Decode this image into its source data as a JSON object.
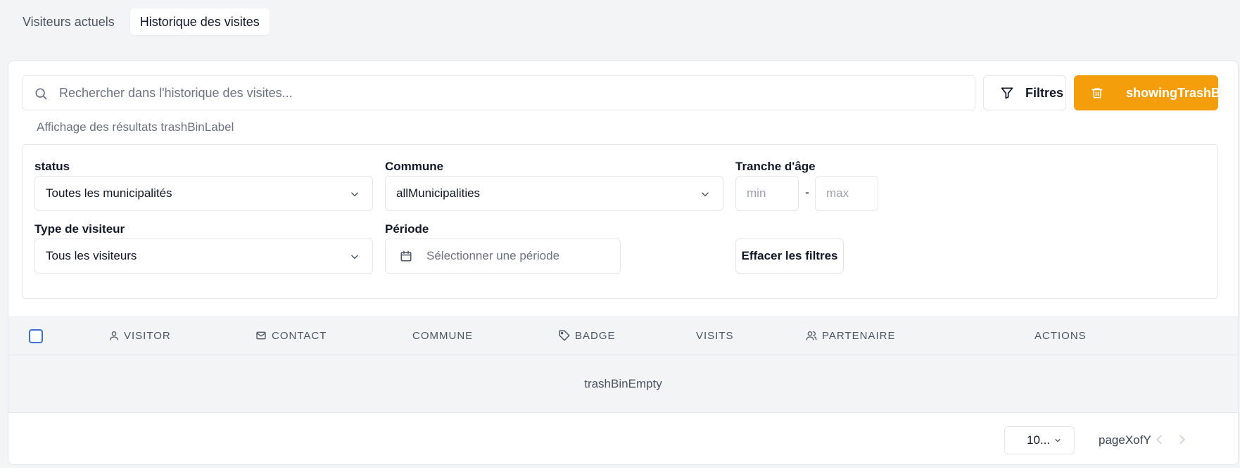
{
  "tabs": [
    {
      "label": "Visiteurs actuels",
      "active": false
    },
    {
      "label": "Historique des visites",
      "active": true
    }
  ],
  "search": {
    "placeholder": "Rechercher dans l'historique des visites...",
    "value": "",
    "icon": "search-icon"
  },
  "toolbar": {
    "filters_label": "Filtres",
    "filters_icon": "filter-icon",
    "trash_label": "showingTrashBin",
    "trash_icon": "trash-icon",
    "trash_color": "#f59e0b"
  },
  "results_label": "Affichage des résultats trashBinLabel",
  "filters": {
    "status": {
      "label": "status",
      "value": "Toutes les municipalités"
    },
    "commune": {
      "label": "Commune",
      "value": "allMunicipalities"
    },
    "age": {
      "label": "Tranche d'âge",
      "min_placeholder": "min",
      "max_placeholder": "max",
      "separator": "-"
    },
    "visitor_type": {
      "label": "Type de visiteur",
      "value": "Tous les visiteurs"
    },
    "period": {
      "label": "Période",
      "placeholder": "Sélectionner une période",
      "icon": "calendar-icon"
    },
    "clear_label": "Effacer les filtres"
  },
  "table": {
    "columns": [
      {
        "label": "VISITOR",
        "icon": "user-icon"
      },
      {
        "label": "CONTACT",
        "icon": "mail-icon"
      },
      {
        "label": "COMMUNE",
        "icon": ""
      },
      {
        "label": "BADGE",
        "icon": "tag-icon"
      },
      {
        "label": "VISITS",
        "icon": ""
      },
      {
        "label": "PARTENAIRE",
        "icon": "users-icon"
      },
      {
        "label": "ACTIONS",
        "icon": ""
      }
    ],
    "empty_text": "trashBinEmpty"
  },
  "pagination": {
    "page_size": "10...",
    "page_info": "pageXofY"
  }
}
